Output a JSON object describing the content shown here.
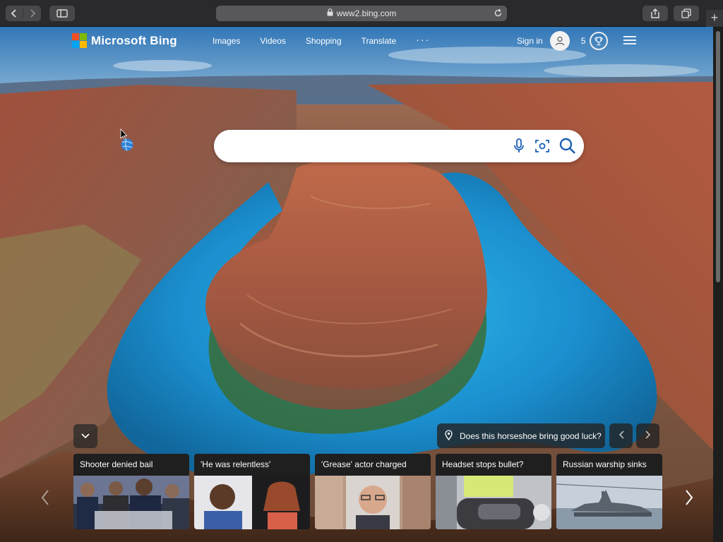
{
  "browser": {
    "url": "www2.bing.com",
    "new_tab_symbol": "+"
  },
  "header": {
    "brand": "Microsoft Bing",
    "logo_colors": [
      "#f25022",
      "#7fba00",
      "#00a4ef",
      "#ffb900"
    ],
    "nav": [
      "Images",
      "Videos",
      "Shopping",
      "Translate"
    ],
    "more_symbol": "···",
    "sign_in": "Sign in",
    "points": "5"
  },
  "search": {
    "value": ""
  },
  "story": {
    "question": "Does this horseshoe bring good luck?"
  },
  "news": [
    {
      "title": "Shooter denied bail"
    },
    {
      "title": "'He was relentless'"
    },
    {
      "title": "'Grease' actor charged"
    },
    {
      "title": "Headset stops bullet?"
    },
    {
      "title": "Russian warship sinks"
    }
  ],
  "colors": {
    "chrome": "#2a2a2c",
    "url_bar": "#58585c",
    "card_bg": "#1f1f1f",
    "search_icon": "#1a5fb4"
  }
}
